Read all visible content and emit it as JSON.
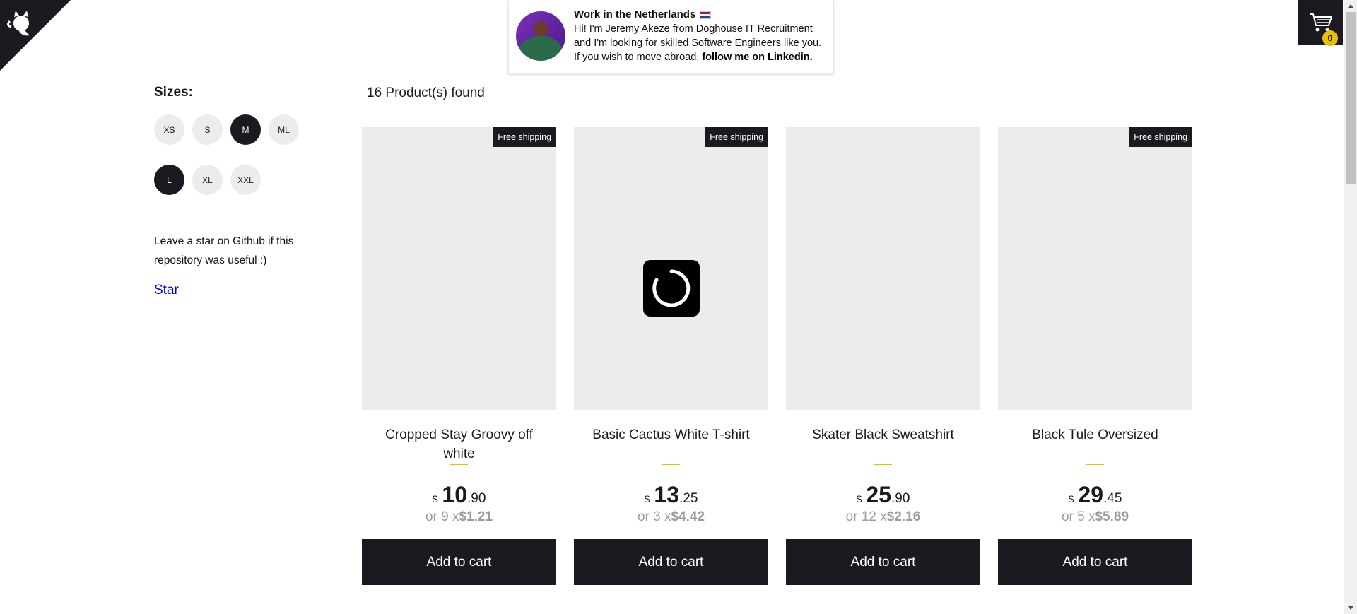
{
  "banner": {
    "title": "Work in the Netherlands",
    "line1": "Hi! I'm Jeremy Akeze from Doghouse IT Recruitment",
    "line2": "and I'm looking for skilled Software Engineers like you.",
    "line3_prefix": "If you wish to move abroad, ",
    "link": "follow me on Linkedin."
  },
  "cart": {
    "count": "0"
  },
  "sidebar": {
    "sizes_title": "Sizes:",
    "sizes": [
      {
        "label": "XS",
        "active": false
      },
      {
        "label": "S",
        "active": false
      },
      {
        "label": "M",
        "active": true
      },
      {
        "label": "ML",
        "active": false
      },
      {
        "label": "L",
        "active": true
      },
      {
        "label": "XL",
        "active": false
      },
      {
        "label": "XXL",
        "active": false
      }
    ],
    "github_note": "Leave a star on Github if this repository was useful :)",
    "star_link": "Star"
  },
  "products_found": "16 Product(s) found",
  "products": [
    {
      "title": "Cropped Stay Groovy off white",
      "free_shipping": "Free shipping",
      "currency": "$",
      "price_int": "10",
      "price_dec": ".90",
      "install_prefix": "or 9 x",
      "install_value": "$1.21",
      "button": "Add to cart"
    },
    {
      "title": "Basic Cactus White T-shirt",
      "free_shipping": "Free shipping",
      "currency": "$",
      "price_int": "13",
      "price_dec": ".25",
      "install_prefix": "or 3 x",
      "install_value": "$4.42",
      "button": "Add to cart"
    },
    {
      "title": "Skater Black Sweatshirt",
      "free_shipping": "",
      "currency": "$",
      "price_int": "25",
      "price_dec": ".90",
      "install_prefix": "or 12 x",
      "install_value": "$2.16",
      "button": "Add to cart"
    },
    {
      "title": "Black Tule Oversized",
      "free_shipping": "Free shipping",
      "currency": "$",
      "price_int": "29",
      "price_dec": ".45",
      "install_prefix": "or 5 x",
      "install_value": "$5.89",
      "button": "Add to cart"
    }
  ],
  "colors": {
    "dark": "#1b1a20",
    "accent": "#eabf00",
    "image_bg": "#ececec"
  }
}
